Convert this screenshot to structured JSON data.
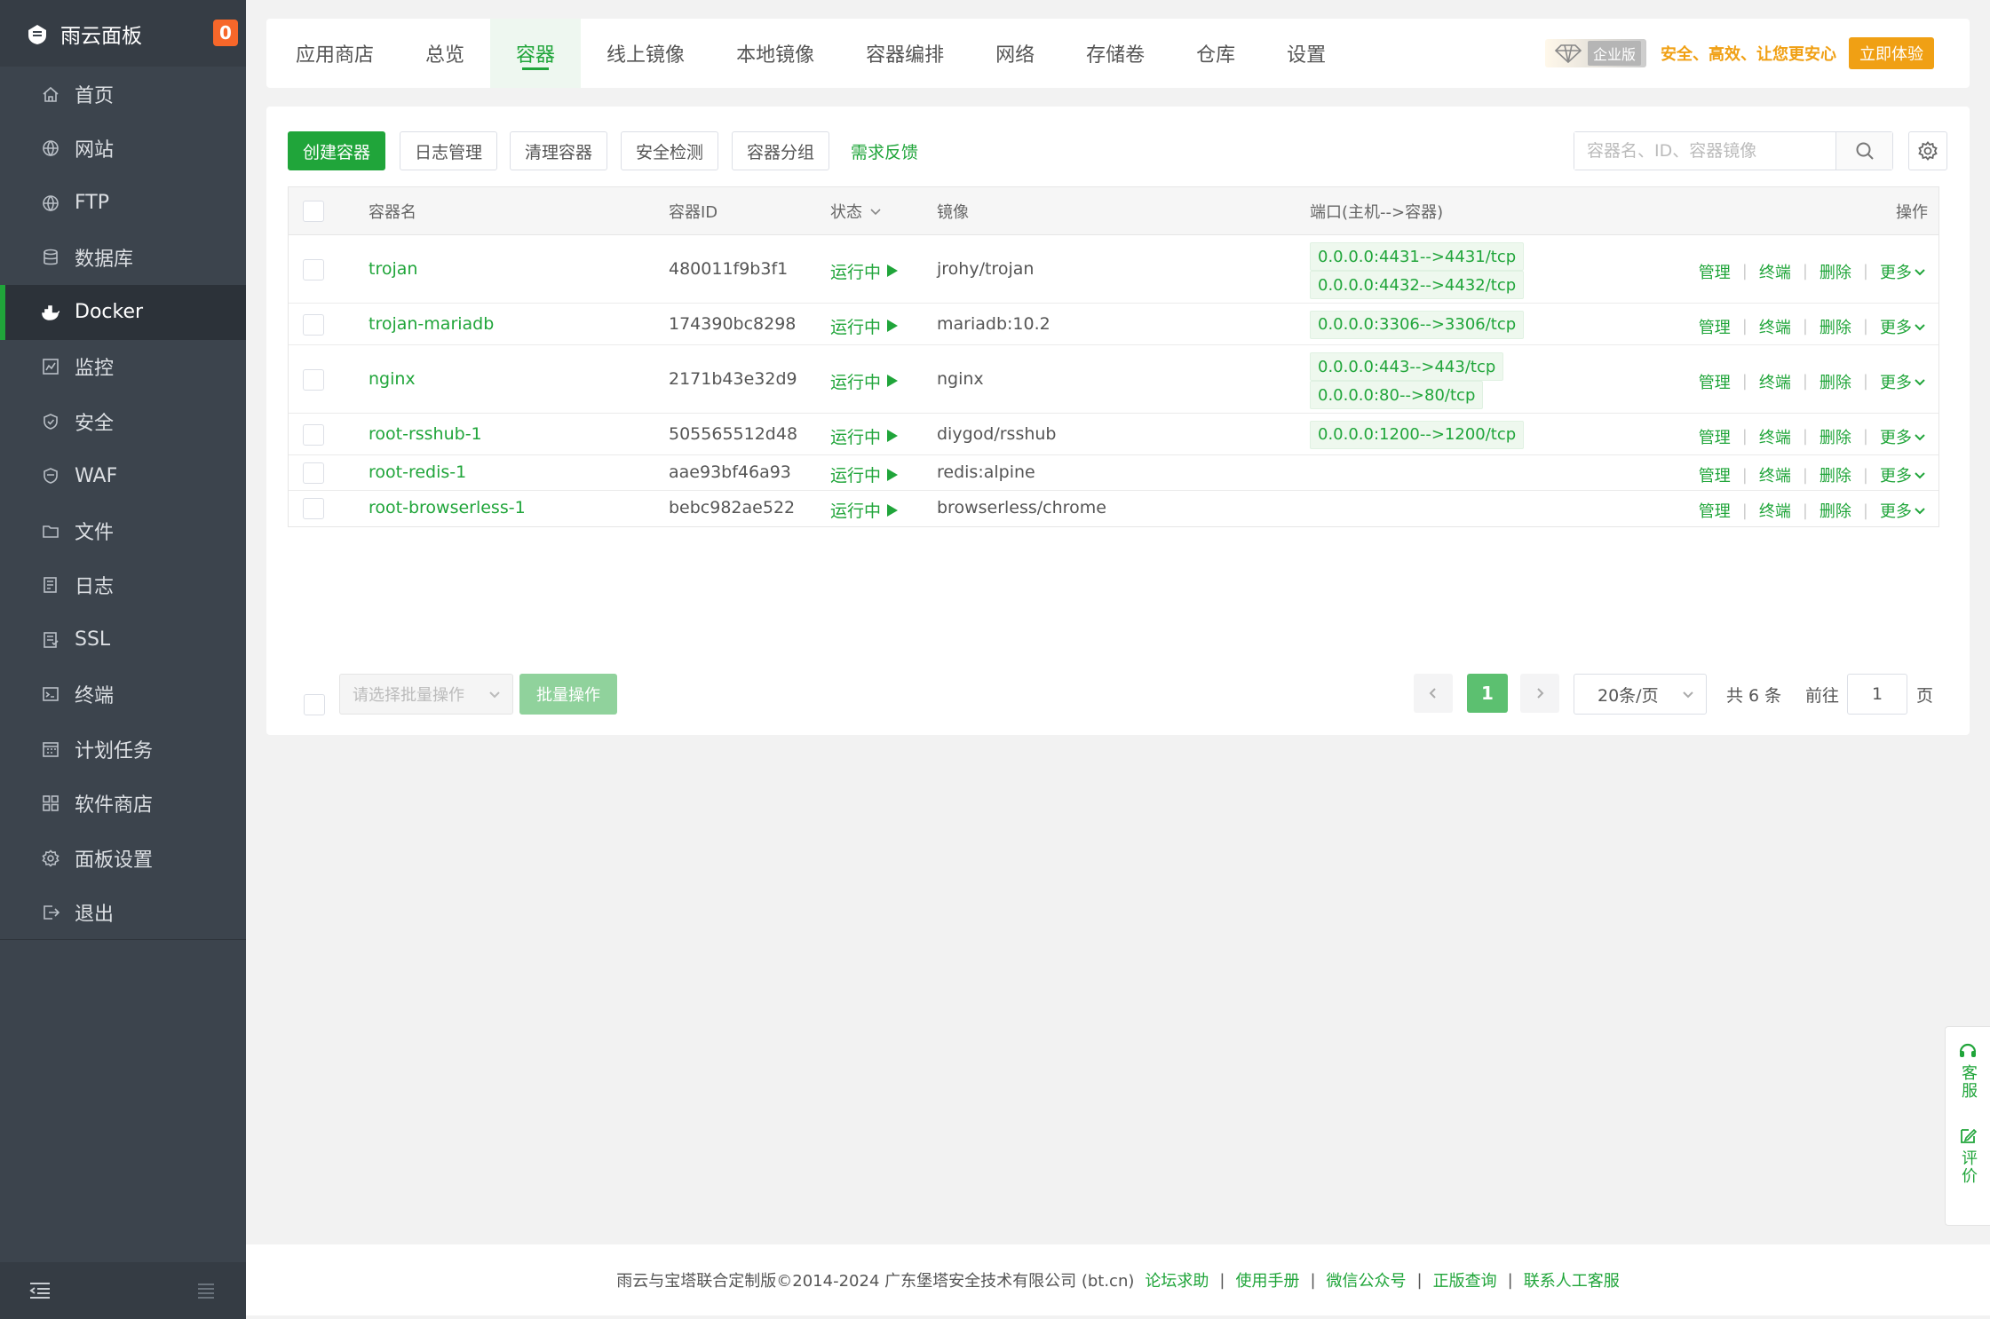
{
  "brand": {
    "title": "雨云面板",
    "badge": "0"
  },
  "sidebar": {
    "items": [
      {
        "label": "首页",
        "icon": "home-icon"
      },
      {
        "label": "网站",
        "icon": "globe-icon"
      },
      {
        "label": "FTP",
        "icon": "ftp-icon"
      },
      {
        "label": "数据库",
        "icon": "database-icon"
      },
      {
        "label": "Docker",
        "icon": "docker-icon",
        "active": true
      },
      {
        "label": "监控",
        "icon": "monitor-icon"
      },
      {
        "label": "安全",
        "icon": "shield-icon"
      },
      {
        "label": "WAF",
        "icon": "waf-icon"
      },
      {
        "label": "文件",
        "icon": "folder-icon"
      },
      {
        "label": "日志",
        "icon": "log-icon"
      },
      {
        "label": "SSL",
        "icon": "ssl-icon"
      },
      {
        "label": "终端",
        "icon": "terminal-icon"
      },
      {
        "label": "计划任务",
        "icon": "calendar-icon"
      },
      {
        "label": "软件商店",
        "icon": "apps-icon"
      },
      {
        "label": "面板设置",
        "icon": "gear-icon"
      },
      {
        "label": "退出",
        "icon": "logout-icon"
      }
    ]
  },
  "tabs": [
    "应用商店",
    "总览",
    "容器",
    "线上镜像",
    "本地镜像",
    "容器编排",
    "网络",
    "存储卷",
    "仓库",
    "设置"
  ],
  "active_tab": "容器",
  "promo": {
    "edition": "企业版",
    "text": "安全、高效、让您更安心",
    "button": "立即体验"
  },
  "toolbar": {
    "create": "创建容器",
    "log_manage": "日志管理",
    "clean": "清理容器",
    "security_check": "安全检测",
    "group": "容器分组",
    "feedback": "需求反馈",
    "search_placeholder": "容器名、ID、容器镜像"
  },
  "table": {
    "headers": {
      "name": "容器名",
      "id": "容器ID",
      "status": "状态",
      "image": "镜像",
      "ports": "端口(主机-->容器)",
      "ops": "操作"
    },
    "op_labels": {
      "manage": "管理",
      "terminal": "终端",
      "delete": "删除",
      "more": "更多"
    },
    "rows": [
      {
        "name": "trojan",
        "id": "480011f9b3f1",
        "status": "运行中",
        "image": "jrohy/trojan",
        "ports": [
          "0.0.0.0:4431-->4431/tcp",
          "0.0.0.0:4432-->4432/tcp"
        ]
      },
      {
        "name": "trojan-mariadb",
        "id": "174390bc8298",
        "status": "运行中",
        "image": "mariadb:10.2",
        "ports": [
          "0.0.0.0:3306-->3306/tcp"
        ]
      },
      {
        "name": "nginx",
        "id": "2171b43e32d9",
        "status": "运行中",
        "image": "nginx",
        "ports": [
          "0.0.0.0:443-->443/tcp",
          "0.0.0.0:80-->80/tcp"
        ]
      },
      {
        "name": "root-rsshub-1",
        "id": "505565512d48",
        "status": "运行中",
        "image": "diygod/rsshub",
        "ports": [
          "0.0.0.0:1200-->1200/tcp"
        ]
      },
      {
        "name": "root-redis-1",
        "id": "aae93bf46a93",
        "status": "运行中",
        "image": "redis:alpine",
        "ports": []
      },
      {
        "name": "root-browserless-1",
        "id": "bebc982ae522",
        "status": "运行中",
        "image": "browserless/chrome",
        "ports": []
      }
    ]
  },
  "batch": {
    "placeholder": "请选择批量操作",
    "button": "批量操作"
  },
  "pagination": {
    "current": "1",
    "page_size": "20条/页",
    "total": "共 6 条",
    "goto_label": "前往",
    "goto_value": "1",
    "page_suffix": "页"
  },
  "footer": {
    "copyright": "雨云与宝塔联合定制版©2014-2024 广东堡塔安全技术有限公司 (bt.cn)",
    "links": [
      "论坛求助",
      "使用手册",
      "微信公众号",
      "正版查询",
      "联系人工客服"
    ]
  },
  "float": {
    "service": "客服",
    "review": "评价"
  },
  "colors": {
    "accent": "#20a53a",
    "sidebar_bg": "#3c444d",
    "promo": "#f0a014",
    "badge": "#f7672a"
  }
}
